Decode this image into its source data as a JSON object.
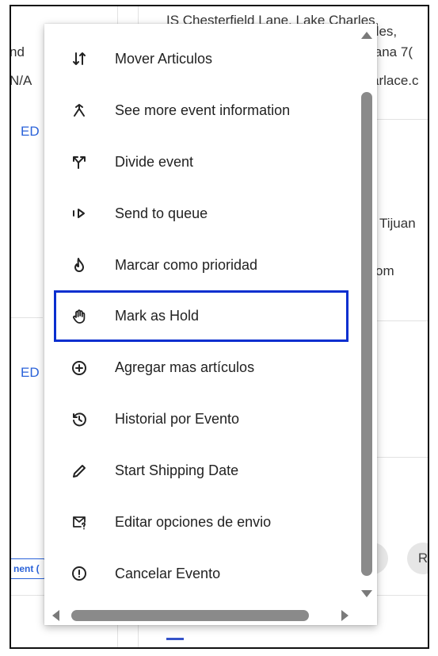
{
  "background": {
    "left_col": [
      "nd",
      "N/A",
      "ED",
      "ED"
    ],
    "tag_label": "nent (",
    "right_col": [
      "IS Chesterfield Lane, Lake Charles,",
      "rles,",
      "iana 7(",
      "arlace.c",
      "Tijuan",
      "om"
    ],
    "chip_labels": [
      "C",
      "R"
    ]
  },
  "menu": {
    "items": [
      {
        "label": "Mover Articulos",
        "icon": "sort-arrows-icon"
      },
      {
        "label": "See more event information",
        "icon": "merge-arrow-icon"
      },
      {
        "label": "Divide event",
        "icon": "split-arrow-icon"
      },
      {
        "label": "Send to queue",
        "icon": "send-queue-icon"
      },
      {
        "label": "Marcar como prioridad",
        "icon": "flame-icon"
      },
      {
        "label": "Mark as Hold",
        "icon": "hand-icon"
      },
      {
        "label": "Agregar mas artículos",
        "icon": "add-circle-icon"
      },
      {
        "label": "Historial por Evento",
        "icon": "history-icon"
      },
      {
        "label": "Start Shipping Date",
        "icon": "pencil-icon"
      },
      {
        "label": "Editar opciones de envio",
        "icon": "mail-question-icon"
      },
      {
        "label": "Cancelar Evento",
        "icon": "alert-circle-icon"
      }
    ],
    "focused_item": "Mark as Hold"
  },
  "colors": {
    "focus_outline": "#0a2fcf",
    "link": "#2b63d9",
    "scrollbar": "#8a8a8a"
  }
}
